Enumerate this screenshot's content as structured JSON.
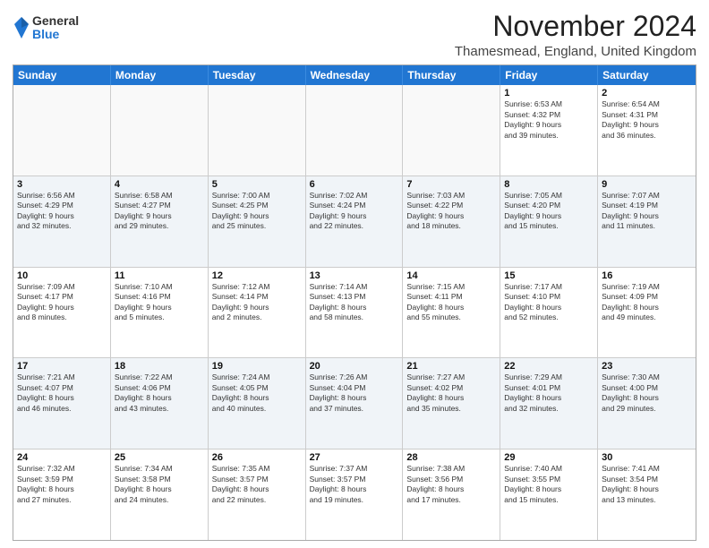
{
  "logo": {
    "general": "General",
    "blue": "Blue"
  },
  "title": "November 2024",
  "location": "Thamesmead, England, United Kingdom",
  "weekdays": [
    "Sunday",
    "Monday",
    "Tuesday",
    "Wednesday",
    "Thursday",
    "Friday",
    "Saturday"
  ],
  "weeks": [
    [
      {
        "day": "",
        "info": "",
        "empty": true
      },
      {
        "day": "",
        "info": "",
        "empty": true
      },
      {
        "day": "",
        "info": "",
        "empty": true
      },
      {
        "day": "",
        "info": "",
        "empty": true
      },
      {
        "day": "",
        "info": "",
        "empty": true
      },
      {
        "day": "1",
        "info": "Sunrise: 6:53 AM\nSunset: 4:32 PM\nDaylight: 9 hours\nand 39 minutes.",
        "empty": false
      },
      {
        "day": "2",
        "info": "Sunrise: 6:54 AM\nSunset: 4:31 PM\nDaylight: 9 hours\nand 36 minutes.",
        "empty": false
      }
    ],
    [
      {
        "day": "3",
        "info": "Sunrise: 6:56 AM\nSunset: 4:29 PM\nDaylight: 9 hours\nand 32 minutes.",
        "empty": false
      },
      {
        "day": "4",
        "info": "Sunrise: 6:58 AM\nSunset: 4:27 PM\nDaylight: 9 hours\nand 29 minutes.",
        "empty": false
      },
      {
        "day": "5",
        "info": "Sunrise: 7:00 AM\nSunset: 4:25 PM\nDaylight: 9 hours\nand 25 minutes.",
        "empty": false
      },
      {
        "day": "6",
        "info": "Sunrise: 7:02 AM\nSunset: 4:24 PM\nDaylight: 9 hours\nand 22 minutes.",
        "empty": false
      },
      {
        "day": "7",
        "info": "Sunrise: 7:03 AM\nSunset: 4:22 PM\nDaylight: 9 hours\nand 18 minutes.",
        "empty": false
      },
      {
        "day": "8",
        "info": "Sunrise: 7:05 AM\nSunset: 4:20 PM\nDaylight: 9 hours\nand 15 minutes.",
        "empty": false
      },
      {
        "day": "9",
        "info": "Sunrise: 7:07 AM\nSunset: 4:19 PM\nDaylight: 9 hours\nand 11 minutes.",
        "empty": false
      }
    ],
    [
      {
        "day": "10",
        "info": "Sunrise: 7:09 AM\nSunset: 4:17 PM\nDaylight: 9 hours\nand 8 minutes.",
        "empty": false
      },
      {
        "day": "11",
        "info": "Sunrise: 7:10 AM\nSunset: 4:16 PM\nDaylight: 9 hours\nand 5 minutes.",
        "empty": false
      },
      {
        "day": "12",
        "info": "Sunrise: 7:12 AM\nSunset: 4:14 PM\nDaylight: 9 hours\nand 2 minutes.",
        "empty": false
      },
      {
        "day": "13",
        "info": "Sunrise: 7:14 AM\nSunset: 4:13 PM\nDaylight: 8 hours\nand 58 minutes.",
        "empty": false
      },
      {
        "day": "14",
        "info": "Sunrise: 7:15 AM\nSunset: 4:11 PM\nDaylight: 8 hours\nand 55 minutes.",
        "empty": false
      },
      {
        "day": "15",
        "info": "Sunrise: 7:17 AM\nSunset: 4:10 PM\nDaylight: 8 hours\nand 52 minutes.",
        "empty": false
      },
      {
        "day": "16",
        "info": "Sunrise: 7:19 AM\nSunset: 4:09 PM\nDaylight: 8 hours\nand 49 minutes.",
        "empty": false
      }
    ],
    [
      {
        "day": "17",
        "info": "Sunrise: 7:21 AM\nSunset: 4:07 PM\nDaylight: 8 hours\nand 46 minutes.",
        "empty": false
      },
      {
        "day": "18",
        "info": "Sunrise: 7:22 AM\nSunset: 4:06 PM\nDaylight: 8 hours\nand 43 minutes.",
        "empty": false
      },
      {
        "day": "19",
        "info": "Sunrise: 7:24 AM\nSunset: 4:05 PM\nDaylight: 8 hours\nand 40 minutes.",
        "empty": false
      },
      {
        "day": "20",
        "info": "Sunrise: 7:26 AM\nSunset: 4:04 PM\nDaylight: 8 hours\nand 37 minutes.",
        "empty": false
      },
      {
        "day": "21",
        "info": "Sunrise: 7:27 AM\nSunset: 4:02 PM\nDaylight: 8 hours\nand 35 minutes.",
        "empty": false
      },
      {
        "day": "22",
        "info": "Sunrise: 7:29 AM\nSunset: 4:01 PM\nDaylight: 8 hours\nand 32 minutes.",
        "empty": false
      },
      {
        "day": "23",
        "info": "Sunrise: 7:30 AM\nSunset: 4:00 PM\nDaylight: 8 hours\nand 29 minutes.",
        "empty": false
      }
    ],
    [
      {
        "day": "24",
        "info": "Sunrise: 7:32 AM\nSunset: 3:59 PM\nDaylight: 8 hours\nand 27 minutes.",
        "empty": false
      },
      {
        "day": "25",
        "info": "Sunrise: 7:34 AM\nSunset: 3:58 PM\nDaylight: 8 hours\nand 24 minutes.",
        "empty": false
      },
      {
        "day": "26",
        "info": "Sunrise: 7:35 AM\nSunset: 3:57 PM\nDaylight: 8 hours\nand 22 minutes.",
        "empty": false
      },
      {
        "day": "27",
        "info": "Sunrise: 7:37 AM\nSunset: 3:57 PM\nDaylight: 8 hours\nand 19 minutes.",
        "empty": false
      },
      {
        "day": "28",
        "info": "Sunrise: 7:38 AM\nSunset: 3:56 PM\nDaylight: 8 hours\nand 17 minutes.",
        "empty": false
      },
      {
        "day": "29",
        "info": "Sunrise: 7:40 AM\nSunset: 3:55 PM\nDaylight: 8 hours\nand 15 minutes.",
        "empty": false
      },
      {
        "day": "30",
        "info": "Sunrise: 7:41 AM\nSunset: 3:54 PM\nDaylight: 8 hours\nand 13 minutes.",
        "empty": false
      }
    ]
  ]
}
